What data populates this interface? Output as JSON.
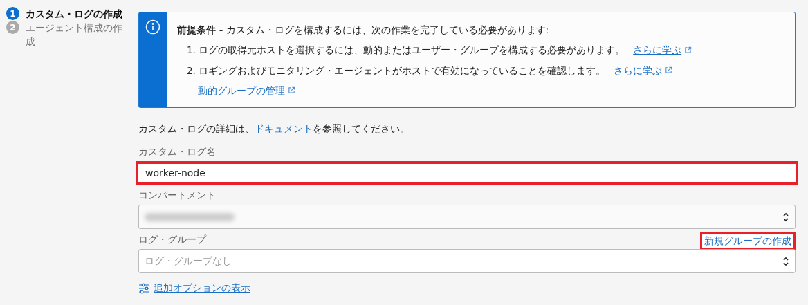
{
  "steps": [
    {
      "number": "1",
      "label": "カスタム・ログの作成",
      "selected": true
    },
    {
      "number": "2",
      "label": "エージェント構成の作成",
      "selected": false
    }
  ],
  "notice": {
    "title": "前提条件 -",
    "text": "カスタム・ログを構成するには、次の作業を完了している必要があります:",
    "items": [
      {
        "number": "1.",
        "text": "ログの取得元ホストを選択するには、動的またはユーザー・グループを構成する必要があります。",
        "link": "さらに学ぶ"
      },
      {
        "number": "2.",
        "text": "ロギングおよびモニタリング・エージェントがホストで有効になっていることを確認します。",
        "link": "さらに学ぶ"
      }
    ],
    "footer_link": "動的グループの管理"
  },
  "doc_note": {
    "before": "カスタム・ログの詳細は、",
    "link": "ドキュメント",
    "after": "を参照してください。"
  },
  "fields": [
    {
      "kind": "text",
      "label": "カスタム・ログ名",
      "value": "worker-node",
      "highlighted": true
    },
    {
      "kind": "select",
      "label": "コンパートメント",
      "redacted": true
    },
    {
      "kind": "select",
      "label": "ログ・グループ",
      "placeholder": "ログ・グループなし",
      "action": {
        "label": "新規グループの作成",
        "highlighted": true
      }
    }
  ],
  "more_options": "追加オプションの表示"
}
